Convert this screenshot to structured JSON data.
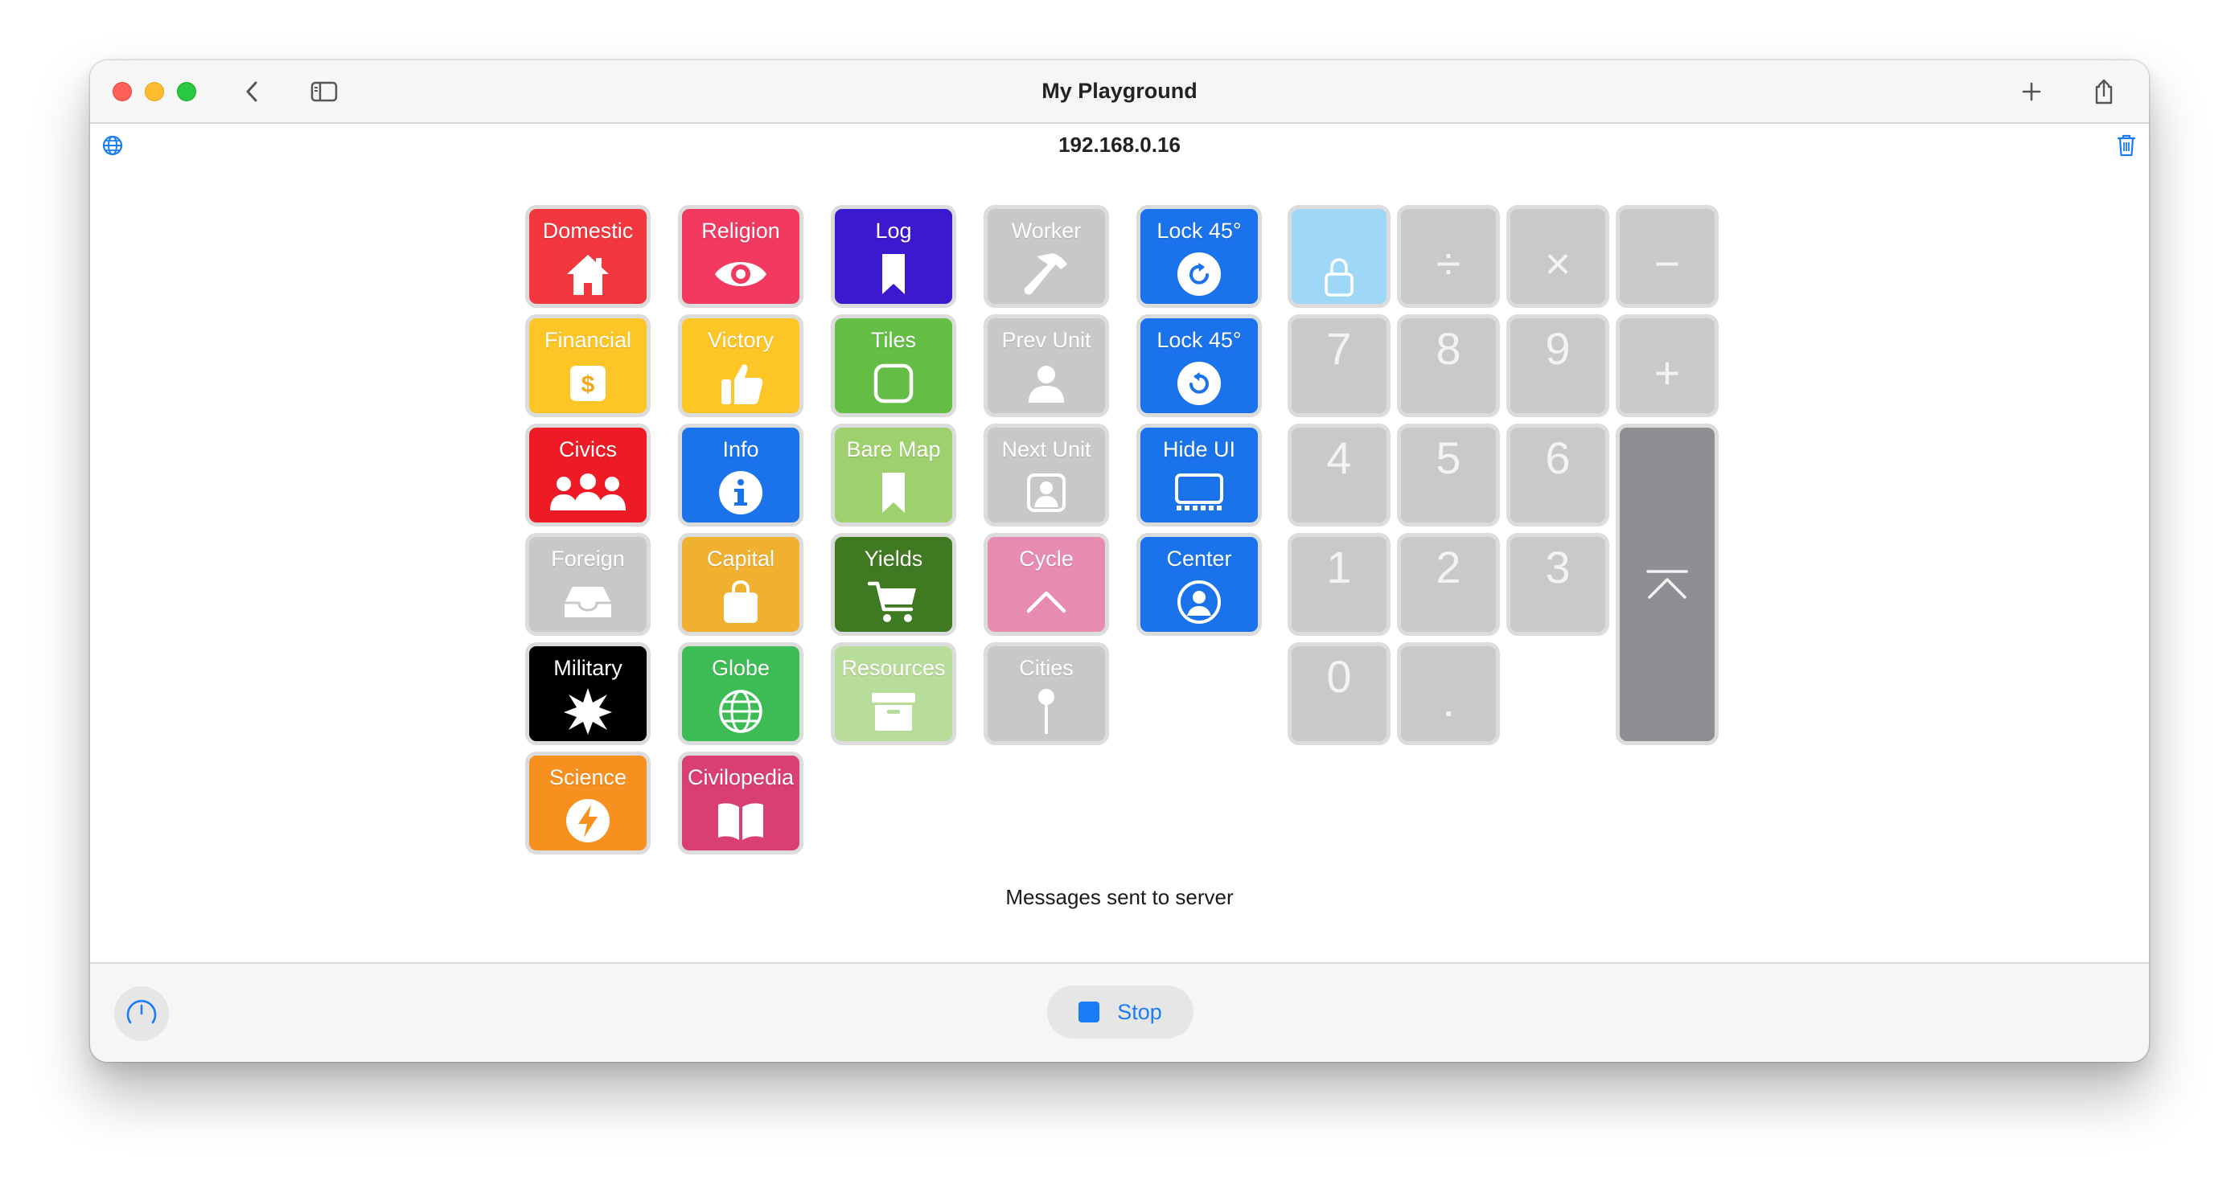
{
  "window": {
    "title": "My Playground"
  },
  "subheader": {
    "address": "192.168.0.16"
  },
  "tiles": [
    {
      "id": "domestic",
      "label": "Domestic",
      "color": "#f2373e",
      "icon": "house-icon",
      "text_color": "#ffffff"
    },
    {
      "id": "religion",
      "label": "Religion",
      "color": "#f23a60",
      "icon": "eye-icon",
      "text_color": "#ffffff"
    },
    {
      "id": "log",
      "label": "Log",
      "color": "#3b19cf",
      "icon": "bookmark-icon",
      "text_color": "#ffffff"
    },
    {
      "id": "worker",
      "label": "Worker",
      "color": "#c8c8c8",
      "icon": "hammer-icon",
      "text_color": "#ffffff"
    },
    {
      "id": "lock45cw",
      "label": "Lock 45°",
      "color": "#1a73ea",
      "icon": "rotate-cw-icon",
      "text_color": "#ffffff"
    },
    {
      "id": "financial",
      "label": "Financial",
      "color": "#fdc525",
      "icon": "dollar-icon",
      "text_color": "#ffffff"
    },
    {
      "id": "victory",
      "label": "Victory",
      "color": "#fdc525",
      "icon": "thumbs-up-icon",
      "text_color": "#ffffff"
    },
    {
      "id": "tiles",
      "label": "Tiles",
      "color": "#64be46",
      "icon": "square-icon",
      "text_color": "#ffffff"
    },
    {
      "id": "prevunit",
      "label": "Prev Unit",
      "color": "#c8c8c8",
      "icon": "person-icon",
      "text_color": "#ffffff"
    },
    {
      "id": "lock45ccw",
      "label": "Lock 45°",
      "color": "#1a73ea",
      "icon": "rotate-ccw-icon",
      "text_color": "#ffffff"
    },
    {
      "id": "civics",
      "label": "Civics",
      "color": "#ee1b26",
      "icon": "people-icon",
      "text_color": "#ffffff"
    },
    {
      "id": "info",
      "label": "Info",
      "color": "#1a73ea",
      "icon": "info-icon",
      "text_color": "#ffffff"
    },
    {
      "id": "baremap",
      "label": "Bare Map",
      "color": "#9ed16d",
      "icon": "bookmark-icon",
      "text_color": "#ffffff"
    },
    {
      "id": "nextunit",
      "label": "Next Unit",
      "color": "#c8c8c8",
      "icon": "person-square-icon",
      "text_color": "#ffffff"
    },
    {
      "id": "hideui",
      "label": "Hide UI",
      "color": "#1a73ea",
      "icon": "display-icon",
      "text_color": "#ffffff"
    },
    {
      "id": "foreign",
      "label": "Foreign",
      "color": "#c8c8c8",
      "icon": "tray-icon",
      "text_color": "#ffffff"
    },
    {
      "id": "capital",
      "label": "Capital",
      "color": "#f0b030",
      "icon": "bag-icon",
      "text_color": "#ffffff"
    },
    {
      "id": "yields",
      "label": "Yields",
      "color": "#3f7a23",
      "icon": "cart-icon",
      "text_color": "#ffffff"
    },
    {
      "id": "cycle",
      "label": "Cycle",
      "color": "#e78bb0",
      "icon": "chevron-up-icon",
      "text_color": "#ffffff"
    },
    {
      "id": "center",
      "label": "Center",
      "color": "#1a73ea",
      "icon": "person-circle-icon",
      "text_color": "#ffffff"
    },
    {
      "id": "military",
      "label": "Military",
      "color": "#000000",
      "icon": "burst-icon",
      "text_color": "#ffffff"
    },
    {
      "id": "globe",
      "label": "Globe",
      "color": "#3dbb55",
      "icon": "globe-icon",
      "text_color": "#ffffff"
    },
    {
      "id": "resources",
      "label": "Resources",
      "color": "#b8dd9a",
      "icon": "archive-icon",
      "text_color": "#ffffff"
    },
    {
      "id": "cities",
      "label": "Cities",
      "color": "#c8c8c8",
      "icon": "pin-icon",
      "text_color": "#ffffff"
    },
    {
      "id": "science",
      "label": "Science",
      "color": "#f7901e",
      "icon": "bolt-icon",
      "text_color": "#ffffff"
    },
    {
      "id": "civilopedia",
      "label": "Civilopedia",
      "color": "#d93f73",
      "icon": "book-icon",
      "text_color": "#ffffff"
    }
  ],
  "keypad": [
    {
      "id": "lock",
      "label": "",
      "icon": "lock-icon",
      "color": "#9fd8f7"
    },
    {
      "id": "divide",
      "label": "÷",
      "color": "#c9c9c9"
    },
    {
      "id": "multiply",
      "label": "×",
      "color": "#c9c9c9"
    },
    {
      "id": "minus",
      "label": "−",
      "color": "#c9c9c9"
    },
    {
      "id": "k7",
      "label": "7",
      "color": "#c9c9c9"
    },
    {
      "id": "k8",
      "label": "8",
      "color": "#c9c9c9"
    },
    {
      "id": "k9",
      "label": "9",
      "color": "#c9c9c9"
    },
    {
      "id": "plus",
      "label": "+",
      "color": "#c9c9c9"
    },
    {
      "id": "k4",
      "label": "4",
      "color": "#c9c9c9"
    },
    {
      "id": "k5",
      "label": "5",
      "color": "#c9c9c9"
    },
    {
      "id": "k6",
      "label": "6",
      "color": "#c9c9c9"
    },
    {
      "id": "k1",
      "label": "1",
      "color": "#c9c9c9"
    },
    {
      "id": "k2",
      "label": "2",
      "color": "#c9c9c9"
    },
    {
      "id": "k3",
      "label": "3",
      "color": "#c9c9c9"
    },
    {
      "id": "k0",
      "label": "0",
      "color": "#c9c9c9"
    },
    {
      "id": "dot",
      "label": ".",
      "color": "#c9c9c9"
    },
    {
      "id": "enter",
      "label": "",
      "icon": "arrow-to-top-icon",
      "color": "#8e8e93"
    }
  ],
  "status": {
    "message": "Messages sent to server"
  },
  "bottom": {
    "stop_label": "Stop"
  },
  "colors": {
    "accent": "#1a7cf5"
  }
}
